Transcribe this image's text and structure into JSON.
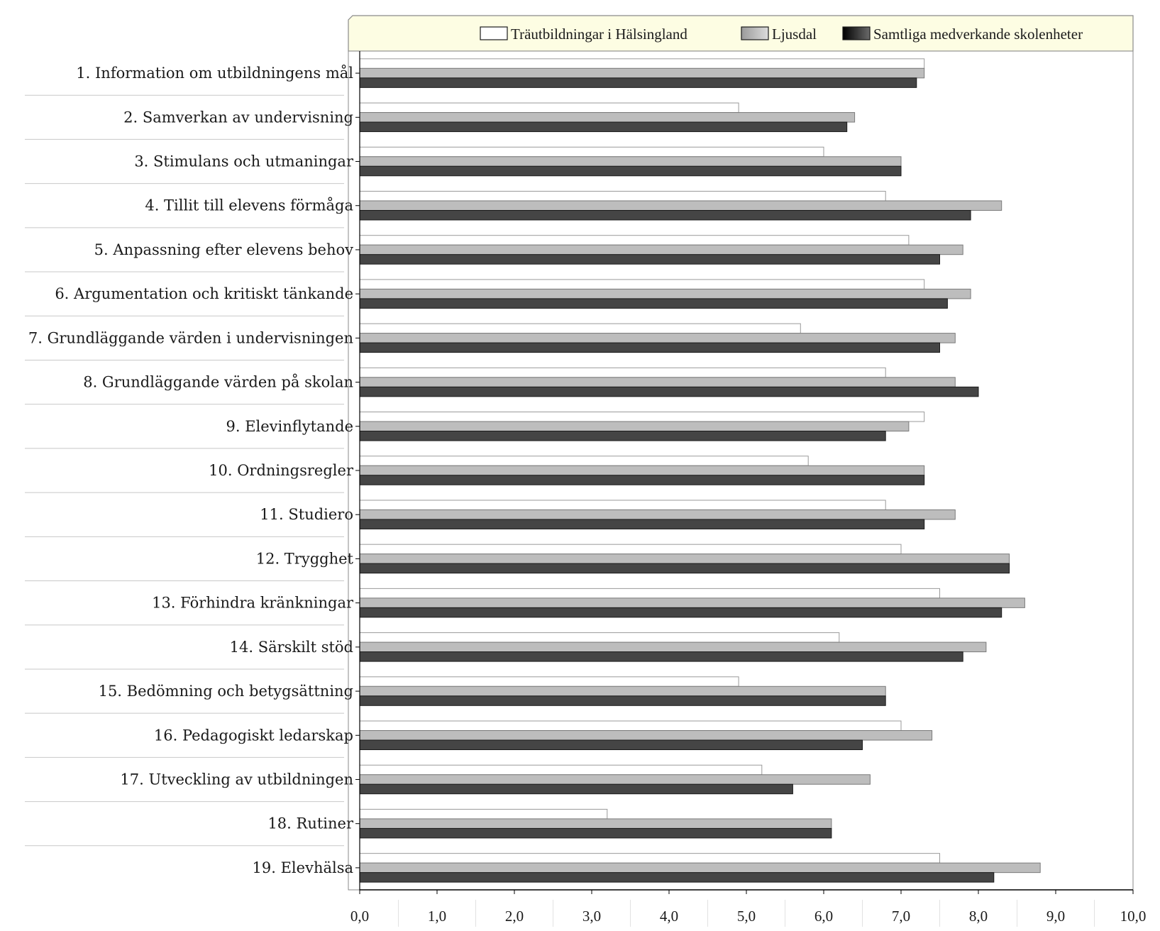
{
  "chart_data": {
    "type": "bar",
    "orientation": "horizontal",
    "title": "",
    "xlabel": "",
    "ylabel": "",
    "xlim": [
      0,
      10
    ],
    "x_ticks": [
      "0,0",
      "1,0",
      "2,0",
      "3,0",
      "4,0",
      "5,0",
      "6,0",
      "7,0",
      "8,0",
      "9,0",
      "10,0"
    ],
    "grid": false,
    "legend_position": "top-right",
    "categories": [
      "1. Information om utbildningens mål",
      "2. Samverkan av undervisning",
      "3. Stimulans och utmaningar",
      "4. Tillit till elevens förmåga",
      "5. Anpassning efter elevens behov",
      "6. Argumentation och kritiskt tänkande",
      "7. Grundläggande värden i undervisningen",
      "8. Grundläggande värden på skolan",
      "9. Elevinflytande",
      "10. Ordningsregler",
      "11. Studiero",
      "12. Trygghet",
      "13. Förhindra kränkningar",
      "14. Särskilt stöd",
      "15. Bedömning och betygsättning",
      "16. Pedagogiskt ledarskap",
      "17. Utveckling av utbildningen",
      "18. Rutiner",
      "19. Elevhälsa"
    ],
    "series": [
      {
        "name": "Träutbildningar i Hälsingland",
        "color": "#ffffff",
        "stroke": "#9a9a9a",
        "values": [
          7.3,
          4.9,
          6.0,
          6.8,
          7.1,
          7.3,
          5.7,
          6.8,
          7.3,
          5.8,
          6.8,
          7.0,
          7.5,
          6.2,
          4.9,
          7.0,
          5.2,
          3.2,
          7.5
        ]
      },
      {
        "name": "Ljusdal",
        "color": "#bdbdbd",
        "stroke": "#7a7a7a",
        "values": [
          7.3,
          6.4,
          7.0,
          8.3,
          7.8,
          7.9,
          7.7,
          7.7,
          7.1,
          7.3,
          7.7,
          8.4,
          8.6,
          8.1,
          6.8,
          7.4,
          6.6,
          6.1,
          8.8
        ]
      },
      {
        "name": "Samtliga medverkande skolenheter",
        "color": "#454545",
        "stroke": "#1a1a1a",
        "values": [
          7.2,
          6.3,
          7.0,
          7.9,
          7.5,
          7.6,
          7.5,
          8.0,
          6.8,
          7.3,
          7.3,
          8.4,
          8.3,
          7.8,
          6.8,
          6.5,
          5.6,
          6.1,
          8.2
        ]
      }
    ],
    "legend_background": "#fdfde3"
  }
}
